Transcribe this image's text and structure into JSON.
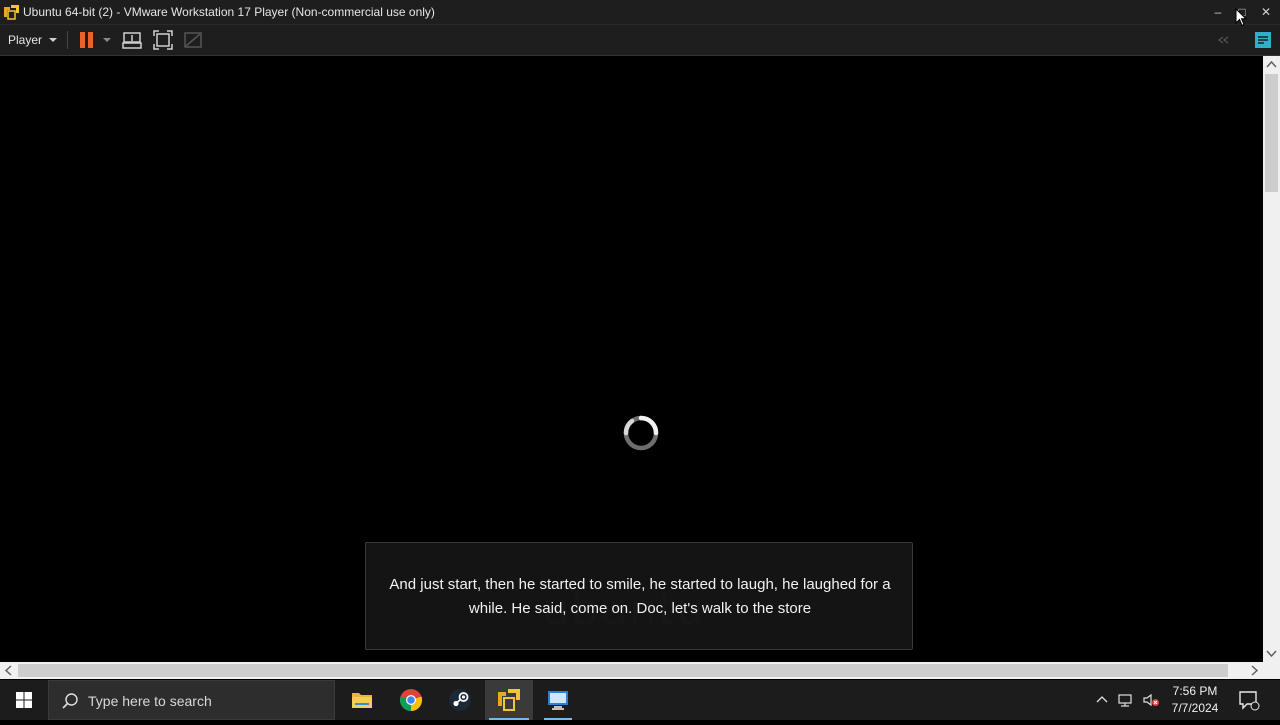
{
  "window": {
    "title": "Ubuntu 64-bit (2) - VMware Workstation 17 Player (Non-commercial use only)",
    "controls": {
      "minimize": "–",
      "maximize": "□",
      "close": "✕"
    }
  },
  "toolbar": {
    "player_menu_label": "Player",
    "icons": [
      "pause-icon",
      "send-ctrl-alt-del-icon",
      "fit-guest-icon",
      "unity-icon",
      "collapse-icon",
      "library-icon"
    ],
    "pause_color": "#e8622a",
    "library_color": "#2fb0c8"
  },
  "guest": {
    "state": "booting",
    "watermark_text": "ubuntu",
    "caption": "And just start, then he started to smile, he started to laugh, he laughed for a while. He said, come on. Doc, let's walk to the store"
  },
  "taskbar": {
    "search_placeholder": "Type here to search",
    "apps": [
      "file-explorer",
      "chrome",
      "steam",
      "vmware-player",
      "remote-desktop"
    ],
    "clock": {
      "time": "7:56 PM",
      "date": "7/7/2024"
    },
    "accent": "#76b9ed"
  }
}
